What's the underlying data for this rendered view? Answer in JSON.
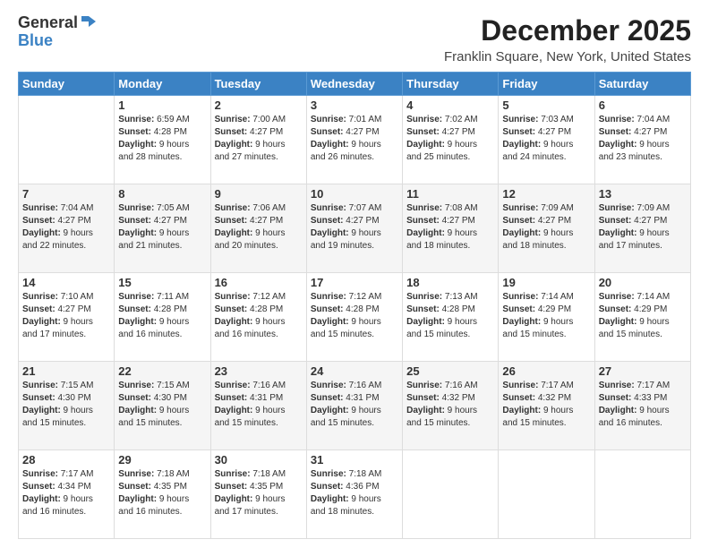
{
  "header": {
    "logo_general": "General",
    "logo_blue": "Blue",
    "month": "December 2025",
    "location": "Franklin Square, New York, United States"
  },
  "days_of_week": [
    "Sunday",
    "Monday",
    "Tuesday",
    "Wednesday",
    "Thursday",
    "Friday",
    "Saturday"
  ],
  "weeks": [
    [
      {
        "day": "",
        "sunrise": "",
        "sunset": "",
        "daylight": ""
      },
      {
        "day": "1",
        "sunrise": "6:59 AM",
        "sunset": "4:28 PM",
        "daylight": "9 hours and 28 minutes."
      },
      {
        "day": "2",
        "sunrise": "7:00 AM",
        "sunset": "4:27 PM",
        "daylight": "9 hours and 27 minutes."
      },
      {
        "day": "3",
        "sunrise": "7:01 AM",
        "sunset": "4:27 PM",
        "daylight": "9 hours and 26 minutes."
      },
      {
        "day": "4",
        "sunrise": "7:02 AM",
        "sunset": "4:27 PM",
        "daylight": "9 hours and 25 minutes."
      },
      {
        "day": "5",
        "sunrise": "7:03 AM",
        "sunset": "4:27 PM",
        "daylight": "9 hours and 24 minutes."
      },
      {
        "day": "6",
        "sunrise": "7:04 AM",
        "sunset": "4:27 PM",
        "daylight": "9 hours and 23 minutes."
      }
    ],
    [
      {
        "day": "7",
        "sunrise": "7:04 AM",
        "sunset": "4:27 PM",
        "daylight": "9 hours and 22 minutes."
      },
      {
        "day": "8",
        "sunrise": "7:05 AM",
        "sunset": "4:27 PM",
        "daylight": "9 hours and 21 minutes."
      },
      {
        "day": "9",
        "sunrise": "7:06 AM",
        "sunset": "4:27 PM",
        "daylight": "9 hours and 20 minutes."
      },
      {
        "day": "10",
        "sunrise": "7:07 AM",
        "sunset": "4:27 PM",
        "daylight": "9 hours and 19 minutes."
      },
      {
        "day": "11",
        "sunrise": "7:08 AM",
        "sunset": "4:27 PM",
        "daylight": "9 hours and 18 minutes."
      },
      {
        "day": "12",
        "sunrise": "7:09 AM",
        "sunset": "4:27 PM",
        "daylight": "9 hours and 18 minutes."
      },
      {
        "day": "13",
        "sunrise": "7:09 AM",
        "sunset": "4:27 PM",
        "daylight": "9 hours and 17 minutes."
      }
    ],
    [
      {
        "day": "14",
        "sunrise": "7:10 AM",
        "sunset": "4:27 PM",
        "daylight": "9 hours and 17 minutes."
      },
      {
        "day": "15",
        "sunrise": "7:11 AM",
        "sunset": "4:28 PM",
        "daylight": "9 hours and 16 minutes."
      },
      {
        "day": "16",
        "sunrise": "7:12 AM",
        "sunset": "4:28 PM",
        "daylight": "9 hours and 16 minutes."
      },
      {
        "day": "17",
        "sunrise": "7:12 AM",
        "sunset": "4:28 PM",
        "daylight": "9 hours and 15 minutes."
      },
      {
        "day": "18",
        "sunrise": "7:13 AM",
        "sunset": "4:28 PM",
        "daylight": "9 hours and 15 minutes."
      },
      {
        "day": "19",
        "sunrise": "7:14 AM",
        "sunset": "4:29 PM",
        "daylight": "9 hours and 15 minutes."
      },
      {
        "day": "20",
        "sunrise": "7:14 AM",
        "sunset": "4:29 PM",
        "daylight": "9 hours and 15 minutes."
      }
    ],
    [
      {
        "day": "21",
        "sunrise": "7:15 AM",
        "sunset": "4:30 PM",
        "daylight": "9 hours and 15 minutes."
      },
      {
        "day": "22",
        "sunrise": "7:15 AM",
        "sunset": "4:30 PM",
        "daylight": "9 hours and 15 minutes."
      },
      {
        "day": "23",
        "sunrise": "7:16 AM",
        "sunset": "4:31 PM",
        "daylight": "9 hours and 15 minutes."
      },
      {
        "day": "24",
        "sunrise": "7:16 AM",
        "sunset": "4:31 PM",
        "daylight": "9 hours and 15 minutes."
      },
      {
        "day": "25",
        "sunrise": "7:16 AM",
        "sunset": "4:32 PM",
        "daylight": "9 hours and 15 minutes."
      },
      {
        "day": "26",
        "sunrise": "7:17 AM",
        "sunset": "4:32 PM",
        "daylight": "9 hours and 15 minutes."
      },
      {
        "day": "27",
        "sunrise": "7:17 AM",
        "sunset": "4:33 PM",
        "daylight": "9 hours and 16 minutes."
      }
    ],
    [
      {
        "day": "28",
        "sunrise": "7:17 AM",
        "sunset": "4:34 PM",
        "daylight": "9 hours and 16 minutes."
      },
      {
        "day": "29",
        "sunrise": "7:18 AM",
        "sunset": "4:35 PM",
        "daylight": "9 hours and 16 minutes."
      },
      {
        "day": "30",
        "sunrise": "7:18 AM",
        "sunset": "4:35 PM",
        "daylight": "9 hours and 17 minutes."
      },
      {
        "day": "31",
        "sunrise": "7:18 AM",
        "sunset": "4:36 PM",
        "daylight": "9 hours and 18 minutes."
      },
      {
        "day": "",
        "sunrise": "",
        "sunset": "",
        "daylight": ""
      },
      {
        "day": "",
        "sunrise": "",
        "sunset": "",
        "daylight": ""
      },
      {
        "day": "",
        "sunrise": "",
        "sunset": "",
        "daylight": ""
      }
    ]
  ],
  "labels": {
    "sunrise": "Sunrise:",
    "sunset": "Sunset:",
    "daylight": "Daylight:"
  }
}
